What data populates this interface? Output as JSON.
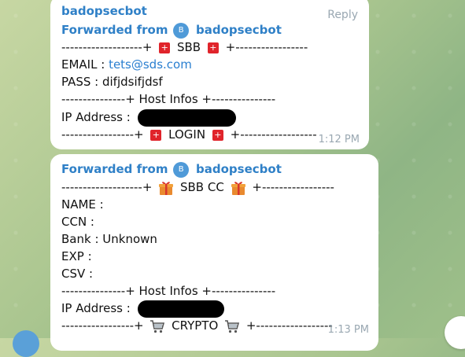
{
  "message1": {
    "sender": "badopsecbot",
    "reply_label": "Reply",
    "forwarded_prefix": "Forwarded from",
    "forwarded_name": "badopsecbot",
    "avatar_letter": "B",
    "header_left": "-------------------+",
    "header_title": "SBB",
    "header_right": "+-----------------",
    "email_label": "EMAIL : ",
    "email_value": "tets@sds.com",
    "pass_line": "PASS : difjdsifjdsf",
    "host_line": "---------------+ Host Infos +---------------",
    "ip_label": "IP Address :",
    "footer_left": "-----------------+",
    "footer_title": "LOGIN",
    "footer_right": "+------------------",
    "time": "1:12 PM"
  },
  "message2": {
    "forwarded_prefix": "Forwarded from",
    "forwarded_name": "badopsecbot",
    "avatar_letter": "B",
    "header_left": "-------------------+",
    "header_title": "SBB CC",
    "header_right": "+-----------------",
    "name_line": "NAME :",
    "ccn_line": "CCN :",
    "bank_line": "Bank : Unknown",
    "exp_line": "EXP :",
    "csv_line": "CSV :",
    "host_line": "---------------+ Host Infos +---------------",
    "ip_label": "IP Address :",
    "footer_left": "-----------------+",
    "footer_title": "CRYPTO",
    "footer_right": "+------------------",
    "time": "1:13 PM"
  }
}
